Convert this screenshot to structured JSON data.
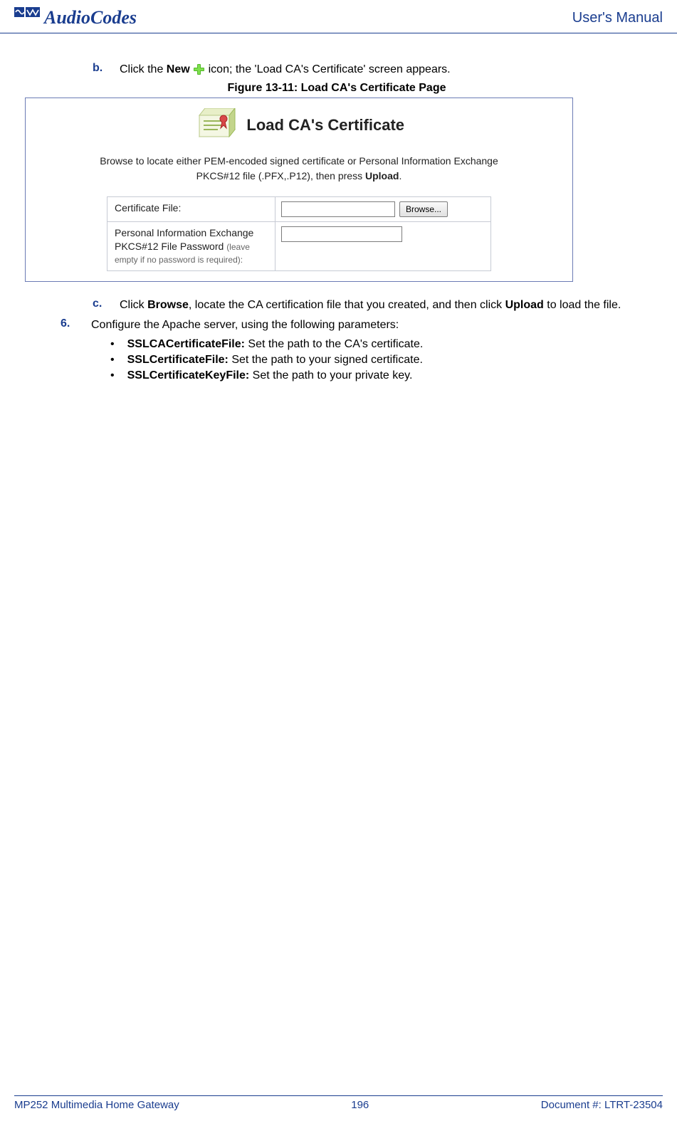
{
  "header": {
    "brand": "AudioCodes",
    "right": "User's Manual"
  },
  "steps": {
    "b": {
      "letter": "b.",
      "pre": "Click the ",
      "bold1": "New",
      "post": " icon; the 'Load CA's Certificate' screen appears."
    },
    "figure_caption": "Figure 13-11: Load CA's Certificate Page",
    "c": {
      "letter": "c.",
      "pre": "Click ",
      "bold1": "Browse",
      "mid": ", locate the CA certification file that you created, and then click ",
      "bold2": "Upload",
      "post": " to load the file."
    },
    "six": {
      "num": "6.",
      "text": "Configure the Apache server, using the following parameters:"
    },
    "bullets": [
      {
        "label": "SSLCACertificateFile:",
        "text": " Set the path to the CA's certificate."
      },
      {
        "label": "SSLCertificateFile:",
        "text": " Set the path to your signed certificate."
      },
      {
        "label": "SSLCertificateKeyFile:",
        "text": " Set the path to your private key."
      }
    ]
  },
  "figure": {
    "title": "Load CA's Certificate",
    "info_line1": "Browse to locate either PEM-encoded signed certificate or Personal Information Exchange",
    "info_line2_pre": "PKCS#12 file (.PFX,.P12), then press ",
    "info_line2_bold": "Upload",
    "info_line2_post": ".",
    "row1_label": "Certificate File:",
    "row1_button": "Browse...",
    "row2_label_main": "Personal Information Exchange PKCS#12 File Password ",
    "row2_label_small": "(leave empty if no password is required):"
  },
  "footer": {
    "left": "MP252 Multimedia Home Gateway",
    "center": "196",
    "right": "Document #: LTRT-23504"
  }
}
